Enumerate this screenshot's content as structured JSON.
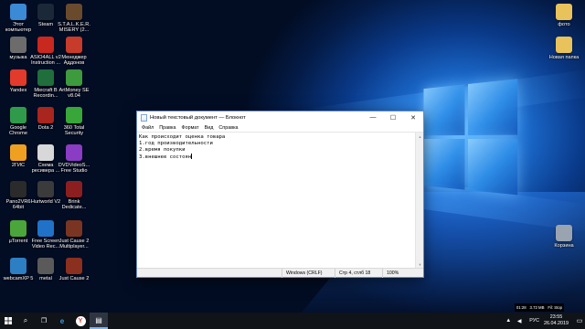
{
  "desktop": {
    "icons": [
      {
        "label": "Этот\nкомпьютер",
        "icon": "computer-icon",
        "color": "#3a8ad6"
      },
      {
        "label": "музыка",
        "icon": "music-folder-icon",
        "color": "#6c6c6c"
      },
      {
        "label": "Yandex",
        "icon": "yandex-browser-icon",
        "color": "#e23a2b"
      },
      {
        "label": "Google\nChrome",
        "icon": "chrome-icon",
        "color": "#2f9b4a"
      },
      {
        "label": "2ГИС",
        "icon": "2gis-icon",
        "color": "#f0a020"
      },
      {
        "label": "Pano2VR6\n64bit",
        "icon": "pano2vr-icon",
        "color": "#2b2b2b"
      },
      {
        "label": "µTorrent",
        "icon": "utorrent-icon",
        "color": "#4aa63a"
      },
      {
        "label": "webcamXP 5",
        "icon": "webcamxp-icon",
        "color": "#2d7fc4"
      },
      {
        "label": "Steam",
        "icon": "steam-icon",
        "color": "#1b2838"
      },
      {
        "label": "ASIO4ALL v2\nInstruction ...",
        "icon": "pdf-icon",
        "color": "#c8281e"
      },
      {
        "label": "Miecraft B\nRecordin...",
        "icon": "recording-icon",
        "color": "#1f6e3c"
      },
      {
        "label": "Dota 2",
        "icon": "dota2-icon",
        "color": "#a8261d"
      },
      {
        "label": "Схема\nресивера ...",
        "icon": "scheme-file-icon",
        "color": "#d8d8d8"
      },
      {
        "label": "Hurtworld V2",
        "icon": "hurtworld-icon",
        "color": "#3b3b3b"
      },
      {
        "label": "Free Screen\nVideo Rec...",
        "icon": "screen-recorder-icon",
        "color": "#1f72c8"
      },
      {
        "label": "metal",
        "icon": "folder-icon",
        "color": "#5a5a5a"
      },
      {
        "label": "S.T.A.L.K.E.R.\nMISERY (2...",
        "icon": "stalker-icon",
        "color": "#6a4a2c"
      },
      {
        "label": "Менеджер\nАддонов",
        "icon": "addon-manager-icon",
        "color": "#c63b2a"
      },
      {
        "label": "ArtMoney SE\nv8.04",
        "icon": "artmoney-icon",
        "color": "#3d9a3d"
      },
      {
        "label": "360 Total\nSecurity",
        "icon": "360-security-icon",
        "color": "#39a639"
      },
      {
        "label": "DVDVideoS...\nFree Studio",
        "icon": "dvdvideosoft-icon",
        "color": "#8a3cc4"
      },
      {
        "label": "Brink\nDedicate...",
        "icon": "brink-icon",
        "color": "#8b1f1f"
      },
      {
        "label": "Just Cause 2\nMultiplayer...",
        "icon": "just-cause-icon",
        "color": "#7a3522"
      },
      {
        "label": "Just Cause 2",
        "icon": "just-cause-icon",
        "color": "#8b2f1e"
      }
    ],
    "right_icons": [
      {
        "label": "фото",
        "icon": "photo-folder-icon",
        "color": "#e8c25a"
      },
      {
        "label": "Новая папка",
        "icon": "new-folder-icon",
        "color": "#e8c25a"
      },
      {
        "label": "Корзина",
        "icon": "recycle-bin-icon",
        "color": "#9aa4b0"
      }
    ]
  },
  "notepad": {
    "title": "Новый текстовый документ — Блокнот",
    "controls": {
      "minimize": "—",
      "maximize": "☐",
      "close": "✕"
    },
    "menu": [
      "Файл",
      "Правка",
      "Формат",
      "Вид",
      "Справка"
    ],
    "lines": [
      "Как происходит оценка товара",
      "1.год производительности",
      "2.время покупки",
      "3.внешнее состоян"
    ],
    "status": {
      "encoding": "Windows (CRLF)",
      "position": "Стр 4, стлб 18",
      "zoom": "100%"
    }
  },
  "overlay_tray": {
    "left": "01:28",
    "mid": "3.72 МВ",
    "right": "Fil: Stop"
  },
  "taskbar": {
    "start_icon": "windows-start-icon",
    "pinned": [
      {
        "name": "search",
        "glyph": "⌕"
      },
      {
        "name": "task-view",
        "glyph": "❐"
      },
      {
        "name": "edge",
        "glyph": "e"
      },
      {
        "name": "yandex",
        "glyph": "Y"
      },
      {
        "name": "notepad",
        "glyph": "▤"
      }
    ],
    "tray": {
      "lang": "РУС",
      "time": "23:55",
      "date": "26.04.2019"
    }
  }
}
